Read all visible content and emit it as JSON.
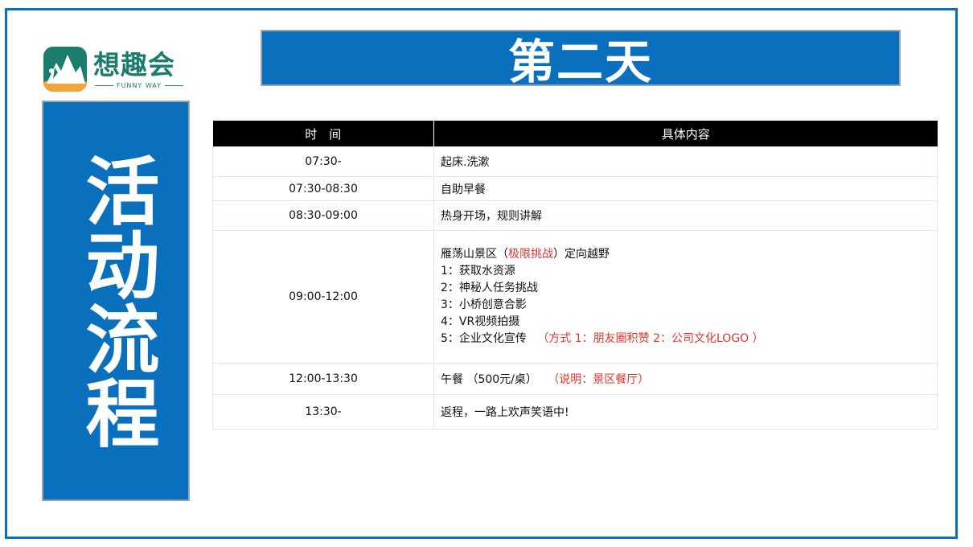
{
  "logo": {
    "name": "想趣会",
    "tagline": "FUNNY WAY"
  },
  "side_title": "活动流程",
  "day_title": "第二天",
  "table": {
    "headers": [
      "时　间",
      "具体内容"
    ],
    "rows": [
      {
        "time": "07:30-",
        "content": "起床.洗漱"
      },
      {
        "time": "07:30-08:30",
        "content": "自助早餐"
      },
      {
        "time": "08:30-09:00",
        "content": "热身开场，规则讲解"
      },
      {
        "time": "09:00-12:00",
        "intro_before": "雁荡山景区（",
        "intro_highlight": "极限挑战",
        "intro_after": "）定向越野",
        "items": [
          "1：获取水资源",
          "2：神秘人任务挑战",
          "3：小桥创意合影",
          "4：VR视频拍摄",
          "5：企业文化宣传"
        ],
        "item5_note": "（方式  1：朋友圈积赞   2：公司文化LOGO   ）"
      },
      {
        "time": "12:00-13:30",
        "content": "午餐   （500元/桌）",
        "note": "（说明：景区餐厅）"
      },
      {
        "time": "13:30-",
        "content": "返程，一路上欢声笑语中!"
      }
    ]
  },
  "colors": {
    "brand_blue": "#0a6fbd",
    "header_black": "#000000",
    "highlight_red": "#e0342e",
    "logo_teal": "#1c7c6e"
  }
}
